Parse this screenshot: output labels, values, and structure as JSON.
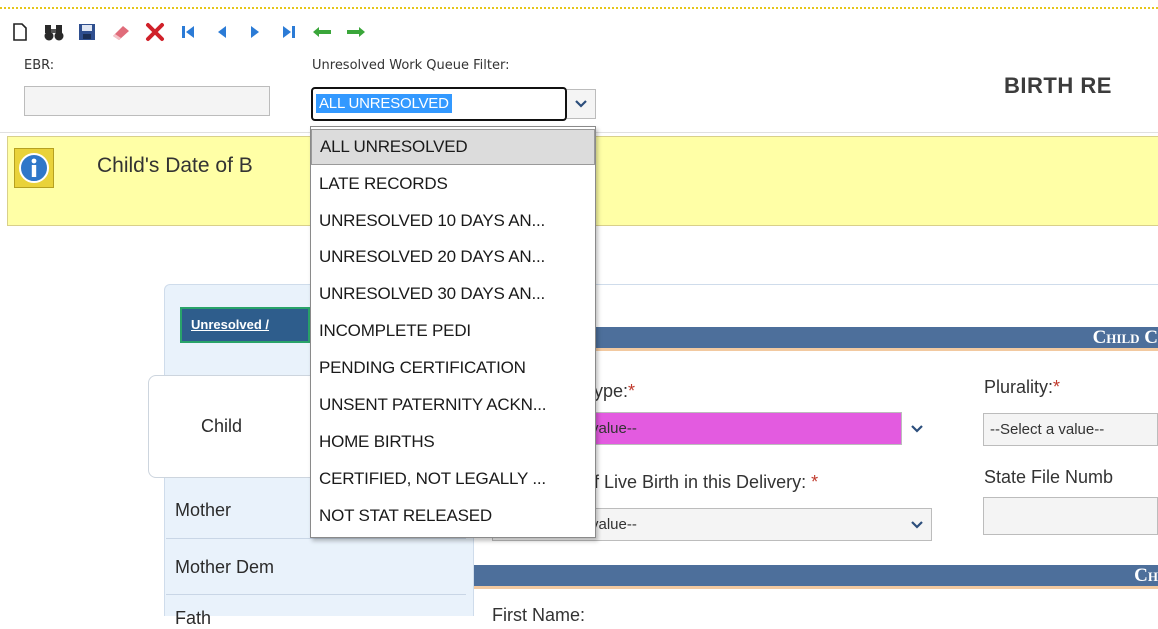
{
  "toolbar": {
    "icons": [
      "new-document-icon",
      "find-binoculars-icon",
      "save-disk-icon",
      "eraser-icon",
      "delete-x-icon",
      "first-record-icon",
      "previous-record-icon",
      "next-record-icon",
      "last-record-icon",
      "back-arrow-icon",
      "forward-arrow-icon"
    ]
  },
  "ebr": {
    "label": "EBR:",
    "value": ""
  },
  "work_queue": {
    "label": "Unresolved Work Queue Filter:",
    "selected": "ALL UNRESOLVED",
    "options": [
      "ALL UNRESOLVED",
      "LATE RECORDS",
      "UNRESOLVED 10 DAYS AN...",
      "UNRESOLVED 20 DAYS AN...",
      "UNRESOLVED 30 DAYS AN...",
      "INCOMPLETE PEDI",
      "PENDING CERTIFICATION",
      "UNSENT PATERNITY ACKN...",
      "HOME BIRTHS",
      "CERTIFIED, NOT LEGALLY ...",
      "NOT STAT RELEASED"
    ]
  },
  "page_title": "BIRTH RE",
  "info_message": "Child's Date of B",
  "nav": {
    "unresolved_tab": "Unresolved /",
    "items": [
      "Child",
      "Mother",
      "Mother Dem",
      "Fath"
    ]
  },
  "main": {
    "section1_title": "Child C",
    "section2_title": "Ch",
    "birth_type_label": "ype:",
    "birth_type_value": "value--",
    "plurality_label": "Plurality:",
    "plurality_value": "--Select a value--",
    "live_birth_label": "f Live Birth in this Delivery:",
    "live_birth_value": "value--",
    "state_file_label": "State File Numb",
    "first_name_label": "First Name:"
  },
  "colors": {
    "info_bar": "#ffffa6",
    "header_blue": "#4d6f9b",
    "highlight_select": "#e35be0",
    "selection_blue": "#3399ff"
  }
}
